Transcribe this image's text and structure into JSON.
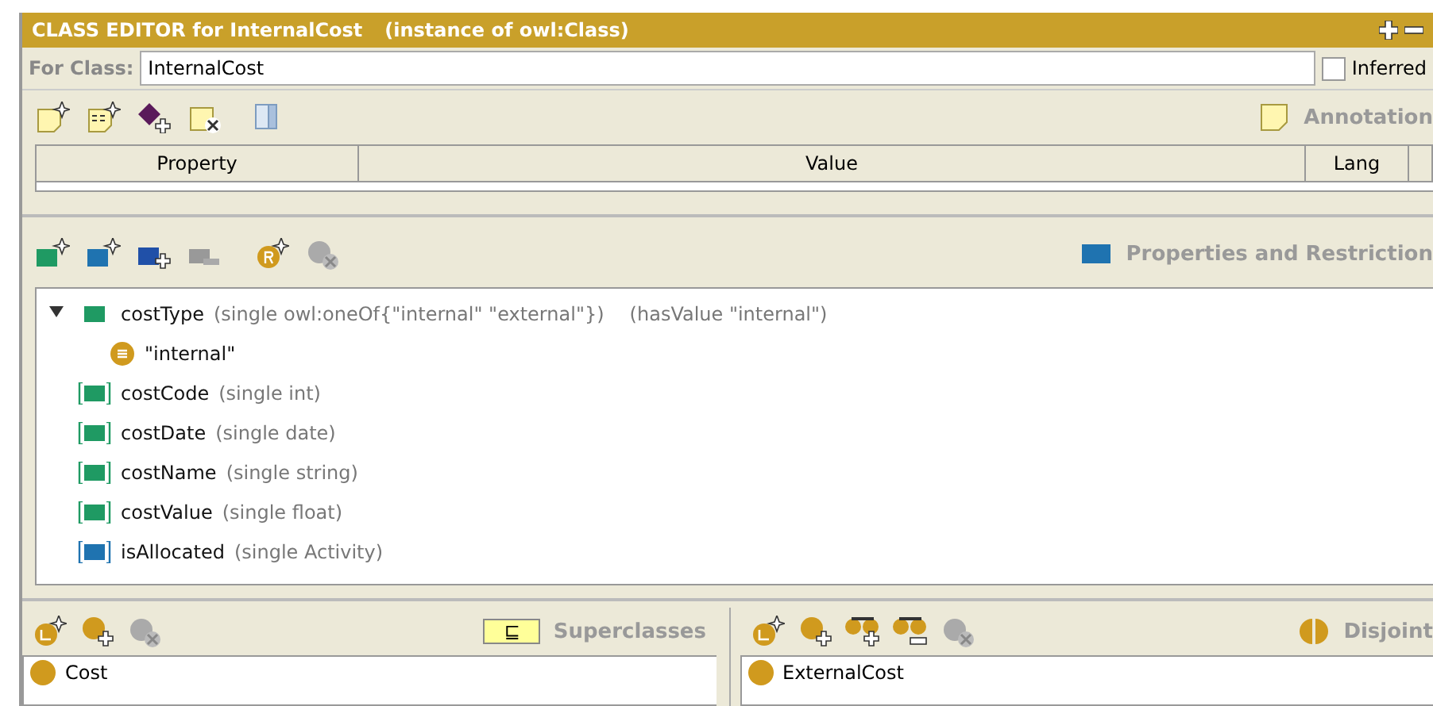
{
  "window": {
    "title": "CLASS EDITOR for InternalCost",
    "subtitle": "(instance of owl:Class)"
  },
  "for_class": {
    "label": "For Class:",
    "value": "InternalCost",
    "inferred": {
      "label": "Inferred",
      "checked": false
    }
  },
  "annotations": {
    "title": "Annotation",
    "columns": [
      "Property",
      "Value",
      "Lang"
    ]
  },
  "properties": {
    "title": "Properties and Restriction",
    "tree": [
      {
        "kind": "datatype",
        "inherited": false,
        "expanded": true,
        "name": "costType",
        "detail": "(single owl:oneOf{\"internal\" \"external\"})",
        "extra": "(hasValue \"internal\")",
        "children": [
          {
            "kind": "value",
            "name": "\"internal\""
          }
        ]
      },
      {
        "kind": "datatype",
        "inherited": true,
        "name": "costCode",
        "detail": "(single int)"
      },
      {
        "kind": "datatype",
        "inherited": true,
        "name": "costDate",
        "detail": "(single date)"
      },
      {
        "kind": "datatype",
        "inherited": true,
        "name": "costName",
        "detail": "(single string)"
      },
      {
        "kind": "datatype",
        "inherited": true,
        "name": "costValue",
        "detail": "(single float)"
      },
      {
        "kind": "object",
        "inherited": true,
        "name": "isAllocated",
        "detail": "(single Activity)"
      }
    ]
  },
  "superclasses": {
    "toggle": "⊑",
    "title": "Superclasses",
    "items": [
      "Cost"
    ]
  },
  "disjoints": {
    "title": "Disjoint",
    "items": [
      "ExternalCost"
    ]
  }
}
